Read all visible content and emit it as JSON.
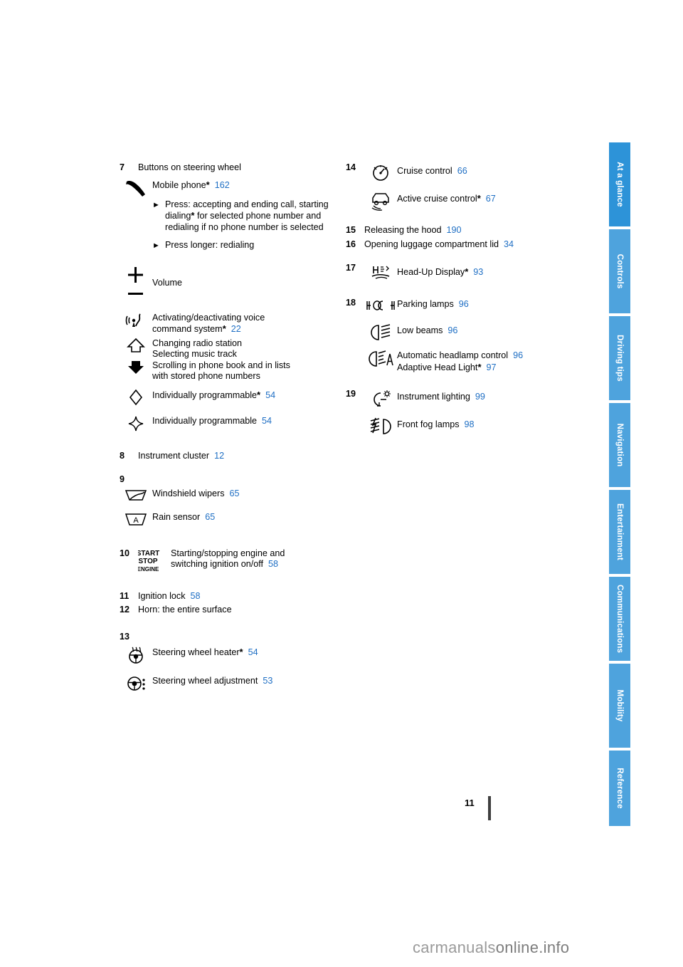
{
  "page": {
    "number": "11",
    "watermark": "carmanualsonline.info"
  },
  "tabs": [
    {
      "label": "At a glance",
      "selected": true
    },
    {
      "label": "Controls",
      "selected": false
    },
    {
      "label": "Driving tips",
      "selected": false
    },
    {
      "label": "Navigation",
      "selected": false
    },
    {
      "label": "Entertainment",
      "selected": false
    },
    {
      "label": "Communications",
      "selected": false
    },
    {
      "label": "Mobility",
      "selected": false
    },
    {
      "label": "Reference",
      "selected": false
    }
  ],
  "left_column": {
    "item7": {
      "num": "7",
      "title": "Buttons on steering wheel",
      "phone": {
        "label": "Mobile phone",
        "star": "*",
        "page": "162"
      },
      "bullets": [
        "Press: accepting and ending call, starting dialing* for selected phone number and redialing if no phone number is selected",
        "Press longer: redialing"
      ],
      "volume": "Volume",
      "voice": {
        "line1": "Activating/deactivating voice",
        "line2": "command system",
        "star": "*",
        "page": "22"
      },
      "radio": {
        "line1": "Changing radio station",
        "line2": "Selecting music track",
        "line3": "Scrolling in phone book and in lists",
        "line4": "with stored phone numbers"
      },
      "prog1": {
        "label": "Individually programmable",
        "star": "*",
        "page": "54"
      },
      "prog2": {
        "label": "Individually programmable",
        "page": "54"
      }
    },
    "item8": {
      "num": "8",
      "label": "Instrument cluster",
      "page": "12"
    },
    "item9": {
      "num": "9",
      "wipers": {
        "label": "Windshield wipers",
        "page": "65"
      },
      "rain": {
        "label": "Rain sensor",
        "page": "65"
      }
    },
    "item10": {
      "num": "10",
      "line1": "Starting/stopping engine and",
      "line2": "switching ignition on/off",
      "page": "58",
      "icon_text_1": "START",
      "icon_text_2": "STOP",
      "icon_text_3": "ENGINE"
    },
    "item11": {
      "num": "11",
      "label": "Ignition lock",
      "page": "58"
    },
    "item12": {
      "num": "12",
      "label": "Horn: the entire surface"
    },
    "item13": {
      "num": "13",
      "heater": {
        "label": "Steering wheel heater",
        "star": "*",
        "page": "54"
      },
      "adjust": {
        "label": "Steering wheel adjustment",
        "page": "53"
      }
    }
  },
  "right_column": {
    "item14": {
      "num": "14",
      "cruise": {
        "label": "Cruise control",
        "page": "66"
      },
      "active": {
        "label": "Active cruise control",
        "star": "*",
        "page": "67"
      }
    },
    "item15": {
      "num": "15",
      "label": "Releasing the hood",
      "page": "190"
    },
    "item16": {
      "num": "16",
      "label": "Opening luggage compartment lid",
      "page": "34"
    },
    "item17": {
      "num": "17",
      "label": "Head-Up Display",
      "star": "*",
      "page": "93"
    },
    "item18": {
      "num": "18",
      "parking": {
        "label": "Parking lamps",
        "page": "96"
      },
      "low": {
        "label": "Low beams",
        "page": "96"
      },
      "auto": {
        "line1": "Automatic headlamp control",
        "page1": "96",
        "line2": "Adaptive Head Light",
        "star": "*",
        "page2": "97"
      }
    },
    "item19": {
      "num": "19",
      "instrument": {
        "label": "Instrument lighting",
        "page": "99"
      },
      "fog": {
        "label": "Front fog lamps",
        "page": "98"
      }
    }
  }
}
